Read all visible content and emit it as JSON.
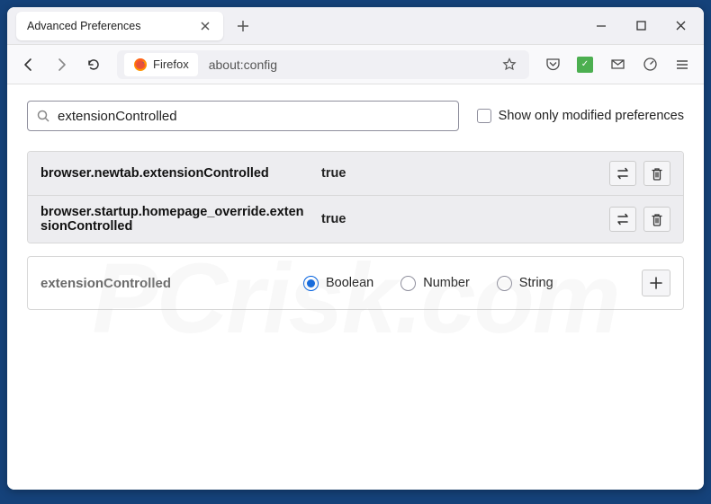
{
  "tab": {
    "title": "Advanced Preferences"
  },
  "urlbar": {
    "identity": "Firefox",
    "url": "about:config"
  },
  "search": {
    "value": "extensionControlled",
    "checkbox_label": "Show only modified preferences"
  },
  "prefs": [
    {
      "name": "browser.newtab.extensionControlled",
      "value": "true"
    },
    {
      "name": "browser.startup.homepage_override.extensionControlled",
      "value": "true"
    }
  ],
  "add": {
    "name": "extensionControlled",
    "options": [
      {
        "label": "Boolean",
        "selected": true
      },
      {
        "label": "Number",
        "selected": false
      },
      {
        "label": "String",
        "selected": false
      }
    ]
  },
  "watermark": "PCrisk.com"
}
